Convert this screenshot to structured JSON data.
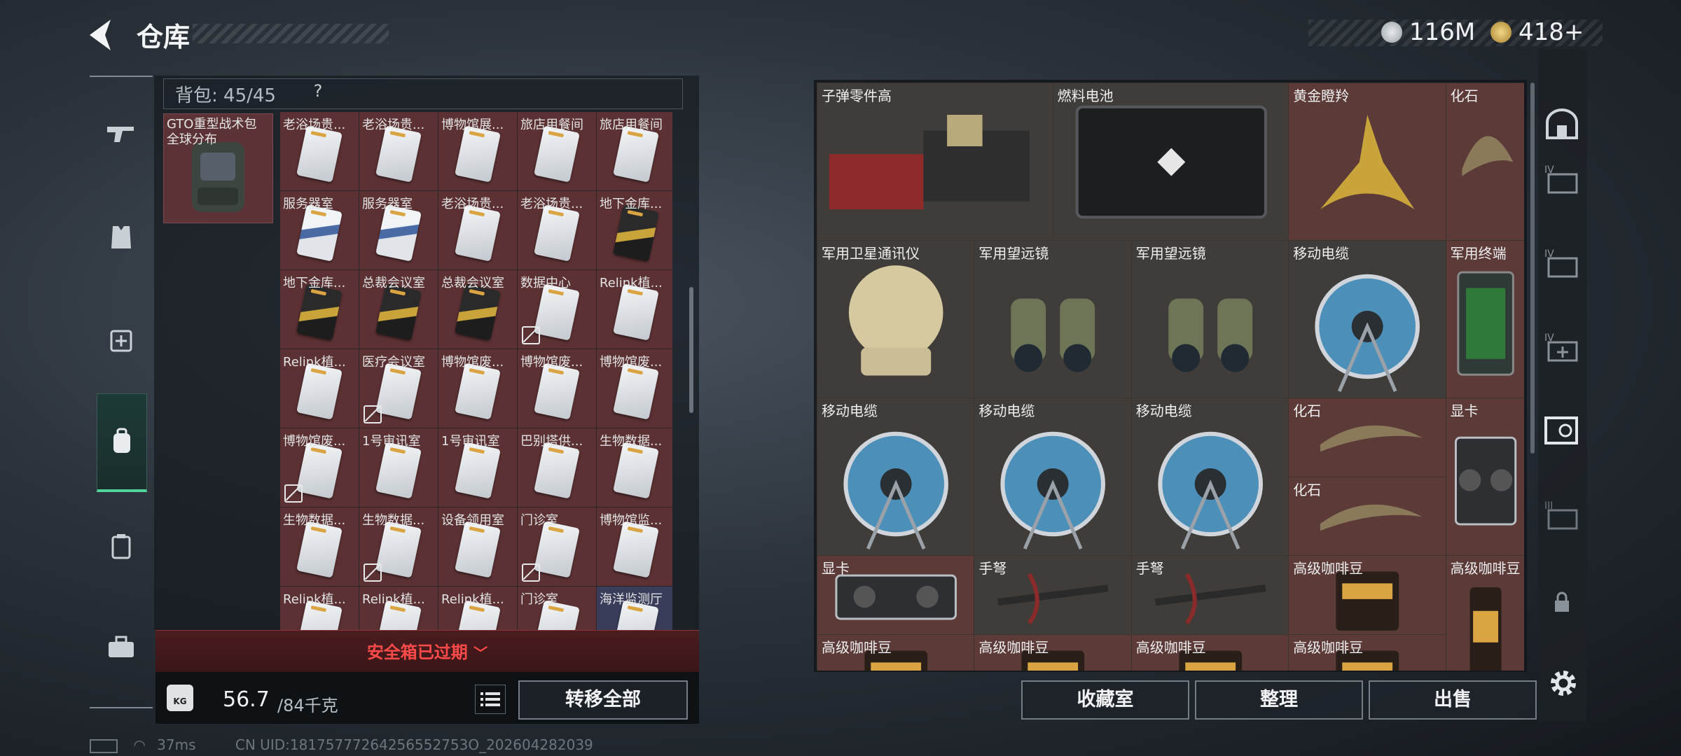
{
  "header": {
    "title": "仓库",
    "currency_1": "116M",
    "currency_2": "418+"
  },
  "backpack": {
    "label": "背包: 45/45",
    "help": "?",
    "bag_name": "GTO重型战术包 全球分布",
    "cards": [
      {
        "label": "老浴场贵...",
        "style": "white"
      },
      {
        "label": "老浴场贵...",
        "style": "white"
      },
      {
        "label": "博物馆展...",
        "style": "white"
      },
      {
        "label": "旅店用餐间",
        "style": "white"
      },
      {
        "label": "旅店用餐间",
        "style": "white"
      },
      {
        "label": "服务器室",
        "style": "blue"
      },
      {
        "label": "服务器室",
        "style": "blue"
      },
      {
        "label": "老浴场贵...",
        "style": "white"
      },
      {
        "label": "老浴场贵...",
        "style": "white"
      },
      {
        "label": "地下金库...",
        "style": "gold"
      },
      {
        "label": "地下金库...",
        "style": "gold"
      },
      {
        "label": "总裁会议室",
        "style": "gold"
      },
      {
        "label": "总裁会议室",
        "style": "gold"
      },
      {
        "label": "数据中心",
        "style": "white",
        "flag": true
      },
      {
        "label": "Relink植...",
        "style": "white"
      },
      {
        "label": "Relink植...",
        "style": "white"
      },
      {
        "label": "医疗会议室",
        "style": "white",
        "flag": true
      },
      {
        "label": "博物馆废...",
        "style": "white"
      },
      {
        "label": "博物馆废...",
        "style": "white"
      },
      {
        "label": "博物馆废...",
        "style": "white"
      },
      {
        "label": "博物馆废...",
        "style": "white",
        "flag": true
      },
      {
        "label": "1号审讯室",
        "style": "white"
      },
      {
        "label": "1号审讯室",
        "style": "white"
      },
      {
        "label": "巴别塔供...",
        "style": "white"
      },
      {
        "label": "生物数据...",
        "style": "white"
      },
      {
        "label": "生物数据...",
        "style": "white"
      },
      {
        "label": "生物数据...",
        "style": "white",
        "flag": true
      },
      {
        "label": "设备领用室",
        "style": "white"
      },
      {
        "label": "门诊室",
        "style": "white",
        "flag": true
      },
      {
        "label": "博物馆监...",
        "style": "white"
      },
      {
        "label": "Relink植...",
        "style": "white"
      },
      {
        "label": "Relink植...",
        "style": "white"
      },
      {
        "label": "Relink植...",
        "style": "white"
      },
      {
        "label": "门诊室",
        "style": "white"
      },
      {
        "label": "海洋监测厅",
        "style": "white",
        "cell": "blue"
      }
    ],
    "safe_box": "安全箱已过期",
    "weight_icon": "KG",
    "weight_current": "56.7",
    "weight_max": "/84千克",
    "transfer_all": "转移全部"
  },
  "status": {
    "ping": "37ms",
    "uid": "CN UID:18175777264256552753O_202604282039"
  },
  "stash": {
    "items": [
      {
        "label": "子弹零件高",
        "icon": "ammo-parts-icon",
        "col": 0,
        "row": 0,
        "w": 3,
        "h": 2,
        "bg": "dark"
      },
      {
        "label": "燃料电池",
        "icon": "fuel-cell-icon",
        "col": 3,
        "row": 0,
        "w": 3,
        "h": 2,
        "bg": "dark"
      },
      {
        "label": "黄金瞪羚",
        "icon": "gold-gazelle-icon",
        "col": 6,
        "row": 0,
        "w": 2,
        "h": 2,
        "bg": "red"
      },
      {
        "label": "化石",
        "icon": "fossil-icon",
        "col": 8,
        "row": 0,
        "w": 1,
        "h": 2,
        "bg": "red"
      },
      {
        "label": "军用卫星通讯仪",
        "icon": "satellite-comm-icon",
        "col": 0,
        "row": 2,
        "w": 2,
        "h": 2,
        "bg": "dark"
      },
      {
        "label": "军用望远镜",
        "icon": "binoculars-icon",
        "col": 2,
        "row": 2,
        "w": 2,
        "h": 2,
        "bg": "dark"
      },
      {
        "label": "军用望远镜",
        "icon": "binoculars-icon",
        "col": 4,
        "row": 2,
        "w": 2,
        "h": 2,
        "bg": "dark"
      },
      {
        "label": "移动电缆",
        "icon": "cable-reel-icon",
        "col": 6,
        "row": 2,
        "w": 2,
        "h": 2,
        "bg": "dark"
      },
      {
        "label": "军用终端",
        "icon": "military-terminal-icon",
        "col": 8,
        "row": 2,
        "w": 1,
        "h": 2,
        "bg": "red"
      },
      {
        "label": "移动电缆",
        "icon": "cable-reel-icon",
        "col": 0,
        "row": 4,
        "w": 2,
        "h": 2,
        "bg": "dark"
      },
      {
        "label": "移动电缆",
        "icon": "cable-reel-icon",
        "col": 2,
        "row": 4,
        "w": 2,
        "h": 2,
        "bg": "dark"
      },
      {
        "label": "移动电缆",
        "icon": "cable-reel-icon",
        "col": 4,
        "row": 4,
        "w": 2,
        "h": 2,
        "bg": "dark"
      },
      {
        "label": "化石",
        "icon": "fossil-icon",
        "col": 6,
        "row": 4,
        "w": 2,
        "h": 1,
        "bg": "red"
      },
      {
        "label": "化石",
        "icon": "fossil-icon",
        "col": 6,
        "row": 5,
        "w": 2,
        "h": 1,
        "bg": "red"
      },
      {
        "label": "显卡",
        "icon": "gpu-icon",
        "col": 8,
        "row": 4,
        "w": 1,
        "h": 2,
        "bg": "red"
      },
      {
        "label": "显卡",
        "icon": "gpu-icon",
        "col": 0,
        "row": 6,
        "w": 2,
        "h": 1,
        "bg": "red"
      },
      {
        "label": "手弩",
        "icon": "crossbow-icon",
        "col": 2,
        "row": 6,
        "w": 2,
        "h": 1,
        "bg": "dark"
      },
      {
        "label": "手弩",
        "icon": "crossbow-icon",
        "col": 4,
        "row": 6,
        "w": 2,
        "h": 1,
        "bg": "dark"
      },
      {
        "label": "高级咖啡豆",
        "icon": "coffee-bag-icon",
        "col": 6,
        "row": 6,
        "w": 2,
        "h": 1,
        "bg": "red"
      },
      {
        "label": "高级咖啡豆",
        "icon": "coffee-bag-icon",
        "col": 8,
        "row": 6,
        "w": 1,
        "h": 2,
        "bg": "red"
      },
      {
        "label": "高级咖啡豆",
        "icon": "coffee-bag-icon",
        "col": 0,
        "row": 7,
        "w": 2,
        "h": 1,
        "bg": "red"
      },
      {
        "label": "高级咖啡豆",
        "icon": "coffee-bag-icon",
        "col": 2,
        "row": 7,
        "w": 2,
        "h": 1,
        "bg": "red"
      },
      {
        "label": "高级咖啡豆",
        "icon": "coffee-bag-icon",
        "col": 4,
        "row": 7,
        "w": 2,
        "h": 1,
        "bg": "red"
      },
      {
        "label": "高级咖啡豆",
        "icon": "coffee-bag-icon",
        "col": 6,
        "row": 7,
        "w": 2,
        "h": 1,
        "bg": "red"
      }
    ],
    "collection": "收藏室",
    "organize": "整理",
    "sell": "出售"
  },
  "right_sidebar": {
    "items": [
      "safe-icon",
      "folder-iv-icon",
      "folder-iv-2-icon",
      "medkit-iv-icon",
      "gpu-iv-icon",
      "folder-iii-icon",
      "lock-icon"
    ]
  },
  "colors": {
    "accent_green": "#4fd39b",
    "safe_red": "#ff4a4a",
    "item_red": "#5b3a38"
  }
}
